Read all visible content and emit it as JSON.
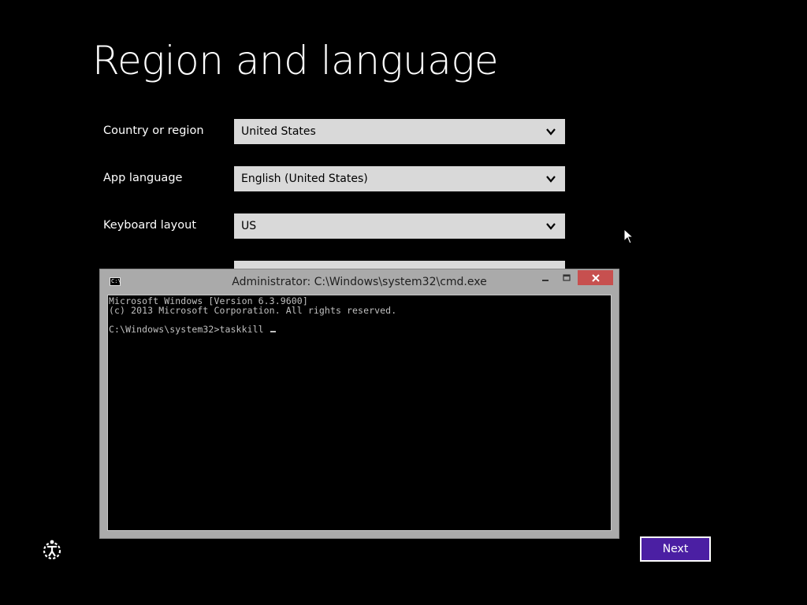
{
  "page": {
    "title": "Region and language"
  },
  "fields": [
    {
      "label": "Country or region",
      "value": "United States"
    },
    {
      "label": "App language",
      "value": "English (United States)"
    },
    {
      "label": "Keyboard layout",
      "value": "US"
    }
  ],
  "cmd": {
    "title": "Administrator: C:\\Windows\\system32\\cmd.exe",
    "icon_text": "C:\\",
    "lines": [
      "Microsoft Windows [Version 6.3.9600]",
      "(c) 2013 Microsoft Corporation. All rights reserved.",
      "",
      "C:\\Windows\\system32>taskkill "
    ]
  },
  "footer": {
    "next_label": "Next"
  },
  "icons": {
    "ease_of_access": "ease-of-access-icon",
    "dropdown": "chevron-down-icon",
    "minimize": "minimize-icon",
    "maximize": "maximize-icon",
    "close": "close-icon",
    "pointer": "mouse-pointer-icon"
  },
  "colors": {
    "background": "#000000",
    "accent": "#4b1fa3",
    "close_button": "#c7504f",
    "select_bg": "#d9d9d9"
  }
}
